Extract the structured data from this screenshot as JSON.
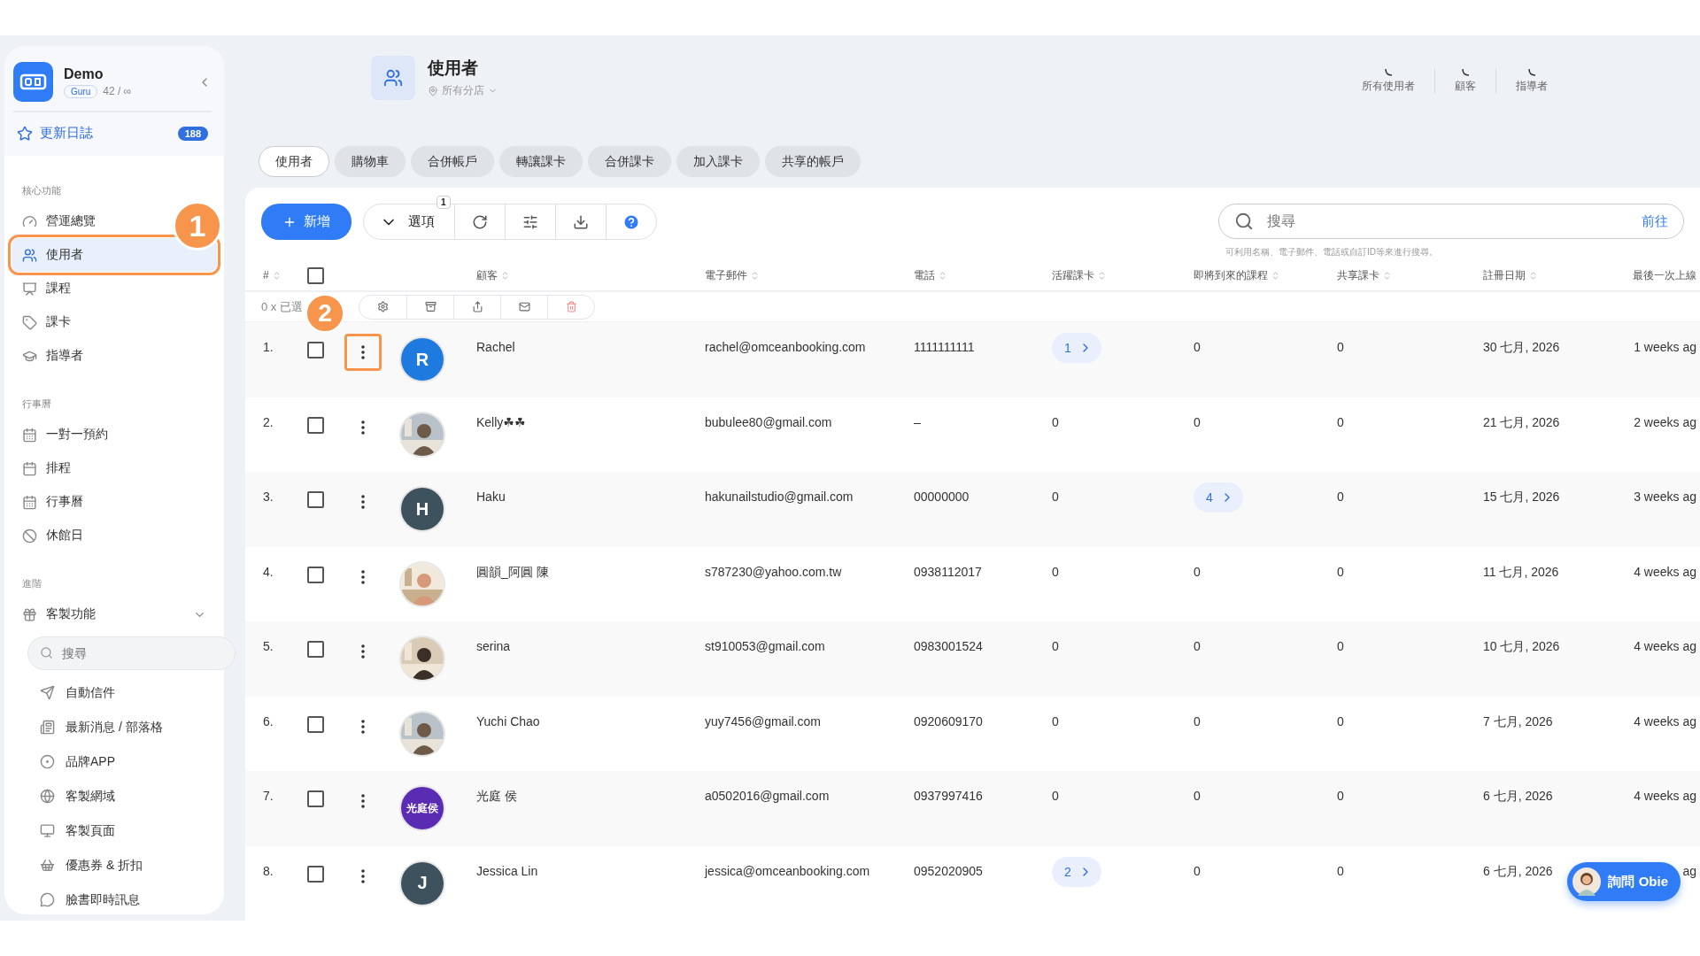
{
  "sidebar": {
    "brand": {
      "name": "Demo",
      "plan": "Guru",
      "quota": "42 / ∞"
    },
    "changelog": {
      "label": "更新日誌",
      "count": "188"
    },
    "sections": [
      {
        "title": "核心功能",
        "items": [
          {
            "label": "營運總覽",
            "selected": false
          },
          {
            "label": "使用者",
            "selected": true,
            "annotation": "1"
          },
          {
            "label": "課程",
            "selected": false
          },
          {
            "label": "課卡",
            "selected": false
          },
          {
            "label": "指導者",
            "selected": false
          }
        ]
      },
      {
        "title": "行事曆",
        "items": [
          {
            "label": "一對一預約",
            "selected": false
          },
          {
            "label": "排程",
            "selected": false
          },
          {
            "label": "行事曆",
            "selected": false
          },
          {
            "label": "休館日",
            "selected": false
          }
        ]
      },
      {
        "title": "進階",
        "group": {
          "label": "客製功能",
          "expanded": true,
          "search_placeholder": "搜尋",
          "children": [
            {
              "label": "自動信件"
            },
            {
              "label": "最新消息 / 部落格"
            },
            {
              "label": "品牌APP"
            },
            {
              "label": "客製網域"
            },
            {
              "label": "客製頁面"
            },
            {
              "label": "優惠券 & 折扣"
            },
            {
              "label": "臉書即時訊息"
            }
          ]
        }
      }
    ]
  },
  "header": {
    "title": "使用者",
    "location": "所有分店",
    "stats": [
      {
        "label": "所有使用者"
      },
      {
        "label": "顧客"
      },
      {
        "label": "指導者"
      }
    ]
  },
  "tabs": [
    {
      "label": "使用者",
      "selected": true
    },
    {
      "label": "購物車",
      "selected": false
    },
    {
      "label": "合併帳戶",
      "selected": false
    },
    {
      "label": "轉讓課卡",
      "selected": false
    },
    {
      "label": "合併課卡",
      "selected": false
    },
    {
      "label": "加入課卡",
      "selected": false
    },
    {
      "label": "共享的帳戶",
      "selected": false
    }
  ],
  "toolbar": {
    "add": "新增",
    "options": "選項",
    "options_badge": "1",
    "search_placeholder": "搜尋",
    "search_go": "前往",
    "search_hint": "可利用名稱、電子郵件、電話或自訂ID等來進行搜尋。"
  },
  "table": {
    "columns": [
      "#",
      "顧客",
      "電子郵件",
      "電話",
      "活躍課卡",
      "即將到來的課程",
      "共享課卡",
      "註冊日期",
      "最後一次上線"
    ],
    "all_selected": false,
    "selection_count": "0 x 已選",
    "rows": [
      {
        "num": "1.",
        "selected": false,
        "menu_annotation": "2",
        "avatar": {
          "kind": "letter",
          "text": "R",
          "color": "#1f7ae0"
        },
        "name": "Rachel",
        "email": "rachel@omceanbooking.com",
        "phone": "1111111111",
        "active_cards": {
          "value": "1",
          "linked": true
        },
        "upcoming": {
          "value": "0",
          "linked": false
        },
        "shared": "0",
        "registered": "30 七月, 2026",
        "last_online": "1 weeks ag"
      },
      {
        "num": "2.",
        "selected": false,
        "name": "Kelly☘☘",
        "email": "bubulee80@gmail.com",
        "phone": "–",
        "active_cards": {
          "value": "0",
          "linked": false
        },
        "upcoming": {
          "value": "0",
          "linked": false
        },
        "shared": "0",
        "registered": "21 七月, 2026",
        "last_online": "2 weeks ag"
      },
      {
        "num": "3.",
        "selected": false,
        "avatar": {
          "kind": "letter",
          "text": "H",
          "color": "#3d525c"
        },
        "name": "Haku",
        "email": "hakunailstudio@gmail.com",
        "phone": "00000000",
        "active_cards": {
          "value": "0",
          "linked": false
        },
        "upcoming": {
          "value": "4",
          "linked": true
        },
        "shared": "0",
        "registered": "15 七月, 2026",
        "last_online": "3 weeks ag"
      },
      {
        "num": "4.",
        "selected": false,
        "name": "圓韻_阿圓 陳",
        "email": "s787230@yahoo.com.tw",
        "phone": "0938112017",
        "active_cards": {
          "value": "0",
          "linked": false
        },
        "upcoming": {
          "value": "0",
          "linked": false
        },
        "shared": "0",
        "registered": "11 七月, 2026",
        "last_online": "4 weeks ag"
      },
      {
        "num": "5.",
        "selected": false,
        "name": "serina",
        "email": "st910053@gmail.com",
        "phone": "0983001524",
        "active_cards": {
          "value": "0",
          "linked": false
        },
        "upcoming": {
          "value": "0",
          "linked": false
        },
        "shared": "0",
        "registered": "10 七月, 2026",
        "last_online": "4 weeks ag"
      },
      {
        "num": "6.",
        "selected": false,
        "name": "Yuchi Chao",
        "email": "yuy7456@gmail.com",
        "phone": "0920609170",
        "active_cards": {
          "value": "0",
          "linked": false
        },
        "upcoming": {
          "value": "0",
          "linked": false
        },
        "shared": "0",
        "registered": "7 七月, 2026",
        "last_online": "4 weeks ag"
      },
      {
        "num": "7.",
        "selected": false,
        "avatar": {
          "kind": "letter",
          "text": "光庭侯",
          "color": "#5a2bb3"
        },
        "name": "光庭 侯",
        "email": "a0502016@gmail.com",
        "phone": "0937997416",
        "active_cards": {
          "value": "0",
          "linked": false
        },
        "upcoming": {
          "value": "0",
          "linked": false
        },
        "shared": "0",
        "registered": "6 七月, 2026",
        "last_online": "4 weeks ag"
      },
      {
        "num": "8.",
        "selected": false,
        "avatar": {
          "kind": "letter",
          "text": "J",
          "color": "#3d525c"
        },
        "name": "Jessica Lin",
        "email": "jessica@omceanbooking.com",
        "phone": "0952020905",
        "active_cards": {
          "value": "2",
          "linked": true
        },
        "upcoming": {
          "value": "0",
          "linked": false
        },
        "shared": "0",
        "registered": "6 七月, 2026",
        "last_online": "ag"
      }
    ]
  },
  "assistant": {
    "label": "詢問 Obie"
  }
}
